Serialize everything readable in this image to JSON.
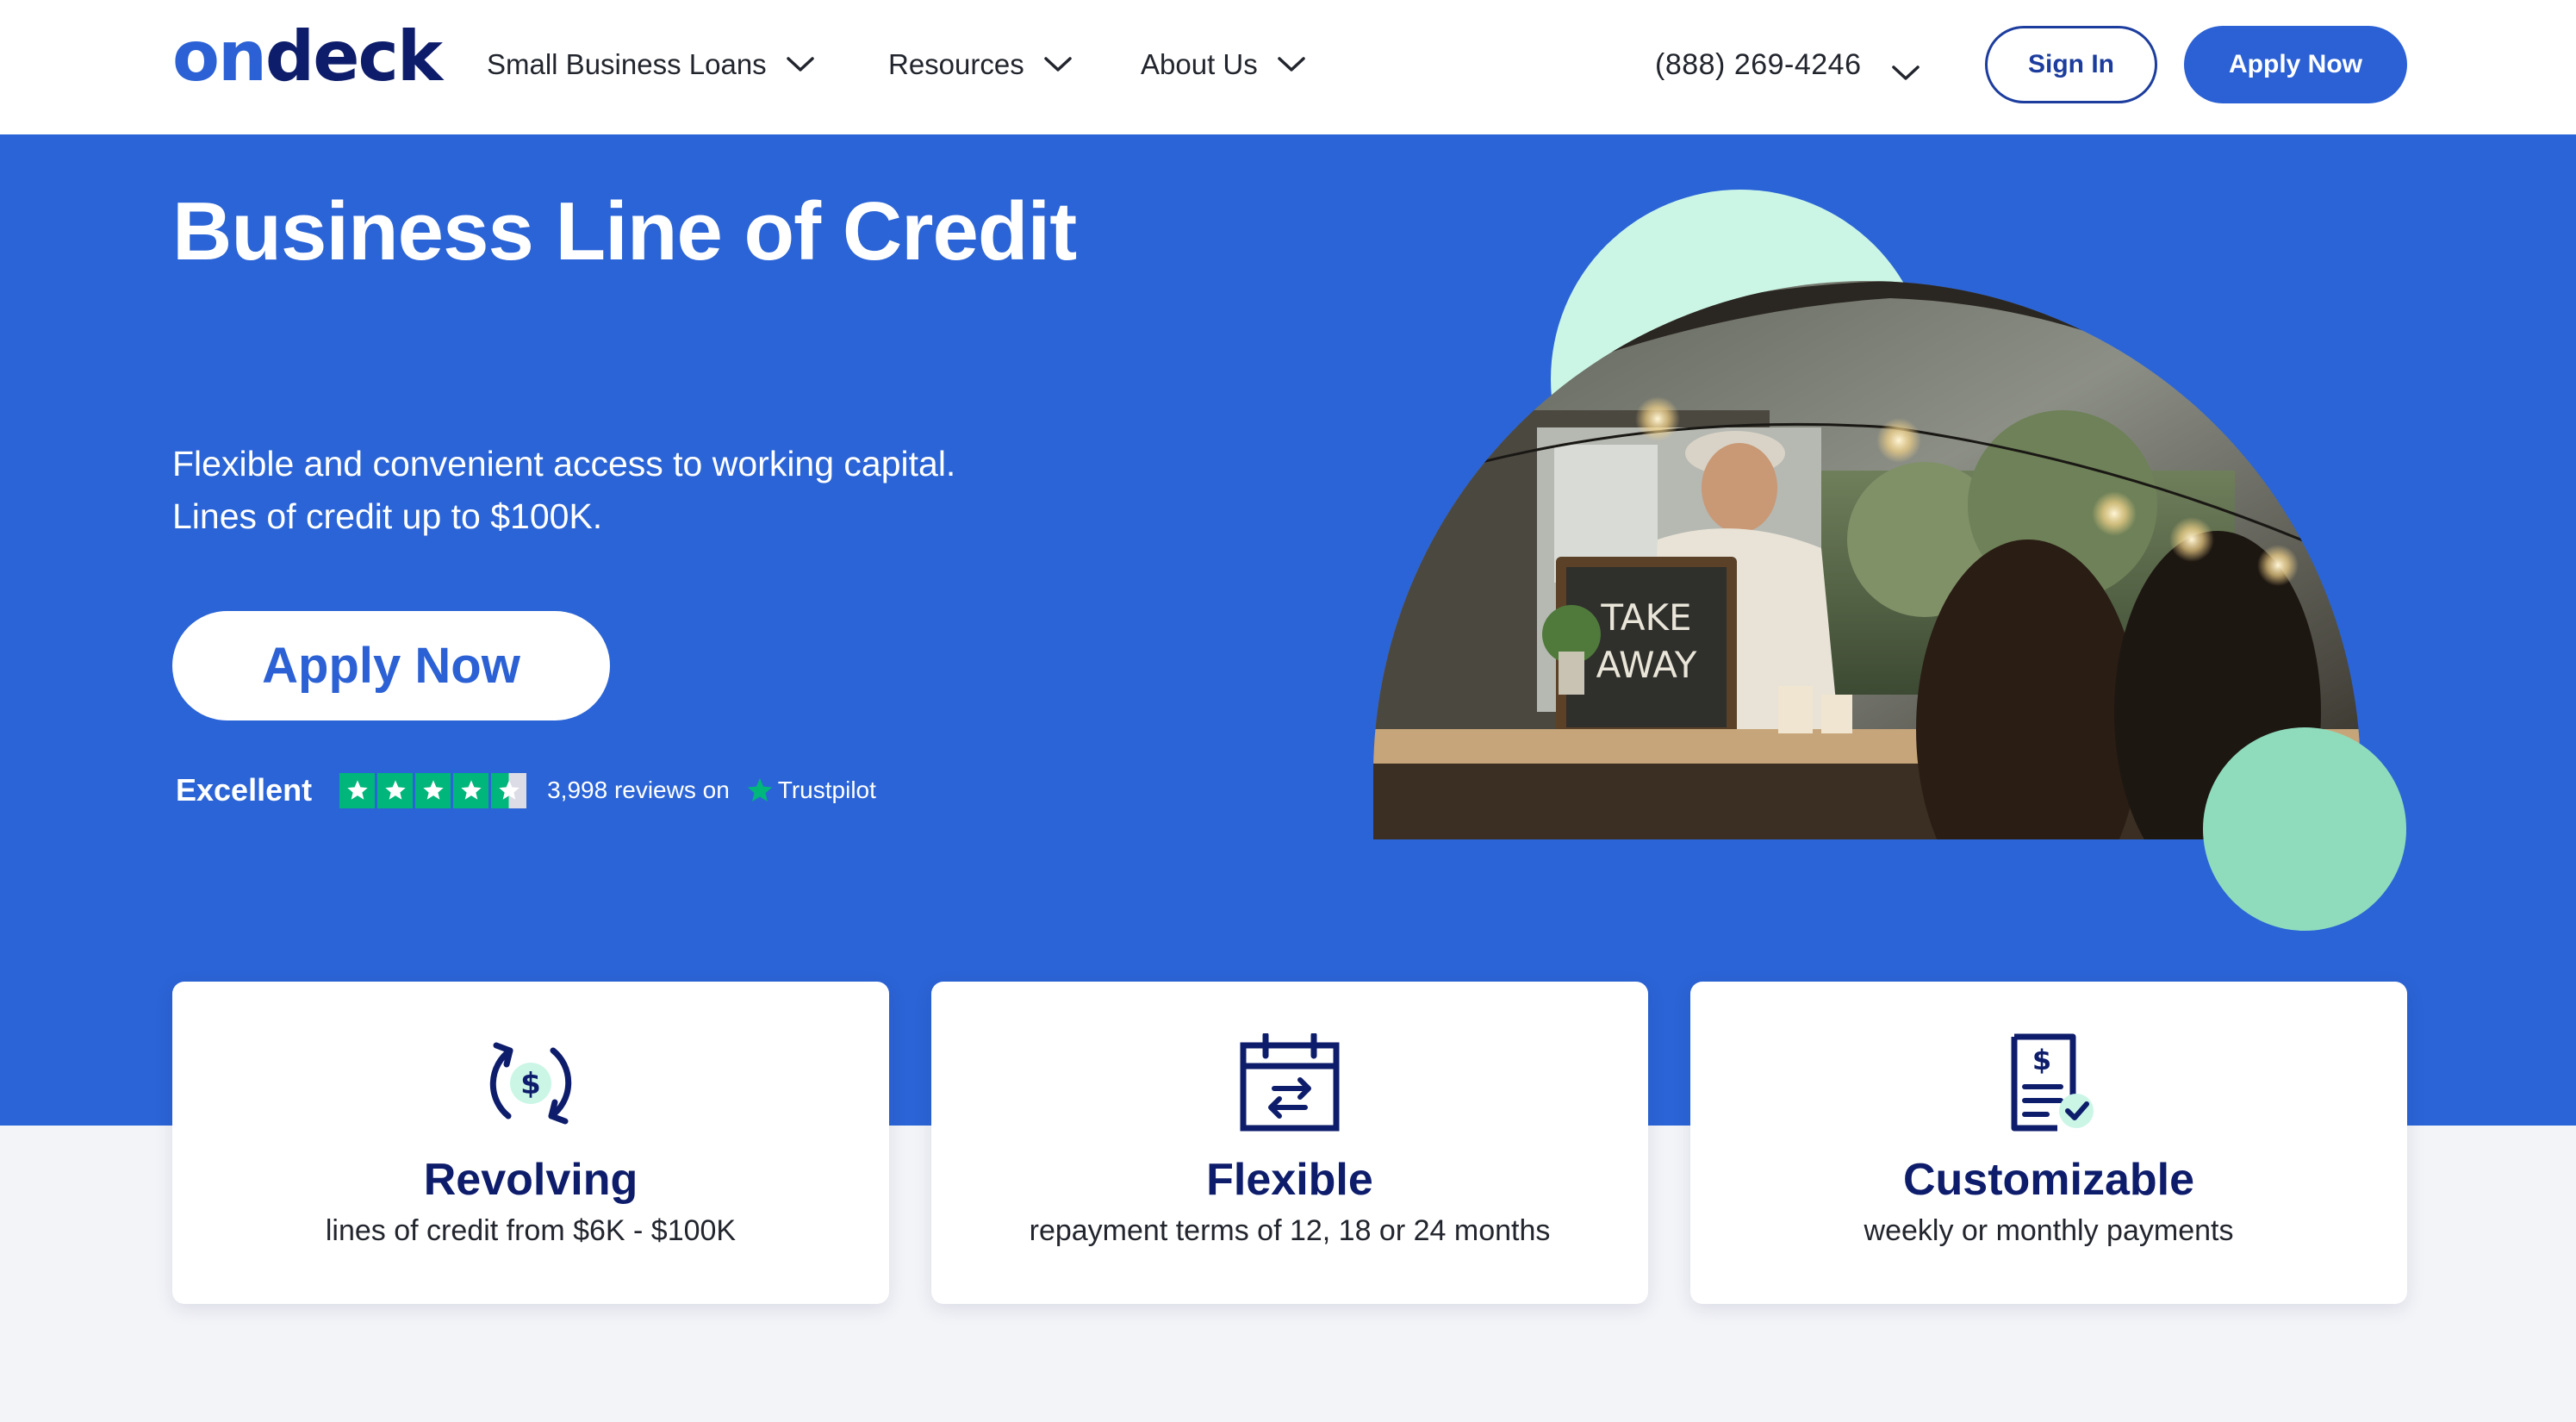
{
  "header": {
    "logo": {
      "part1": "on",
      "part2": "deck"
    },
    "nav": [
      {
        "label": "Small Business Loans"
      },
      {
        "label": "Resources"
      },
      {
        "label": "About Us"
      }
    ],
    "phone": "(888) 269-4246",
    "sign_in": "Sign In",
    "apply_now": "Apply Now"
  },
  "hero": {
    "title": "Business Line of Credit",
    "subtitle_line1": "Flexible and convenient access to working capital.",
    "subtitle_line2": "Lines of credit up to $100K.",
    "apply_button": "Apply Now",
    "trustpilot": {
      "rating_word": "Excellent",
      "stars": 4.5,
      "reviews_text": "3,998 reviews on",
      "brand": "Trustpilot"
    },
    "photo_sign_line1": "TAKE",
    "photo_sign_line2": "AWAY"
  },
  "features": [
    {
      "icon": "revolving-dollar-icon",
      "title": "Revolving",
      "desc": "lines of credit from $6K - $100K"
    },
    {
      "icon": "calendar-exchange-icon",
      "title": "Flexible",
      "desc": "repayment terms of 12, 18 or 24 months"
    },
    {
      "icon": "invoice-check-icon",
      "title": "Customizable",
      "desc": "weekly or monthly payments"
    }
  ],
  "colors": {
    "brand_blue": "#2b61d5",
    "hero_blue": "#2b64d6",
    "navy": "#0e1d6b",
    "mint_light": "#cbf6e6",
    "mint": "#8fdcbd",
    "trustpilot_green": "#00b67a"
  }
}
